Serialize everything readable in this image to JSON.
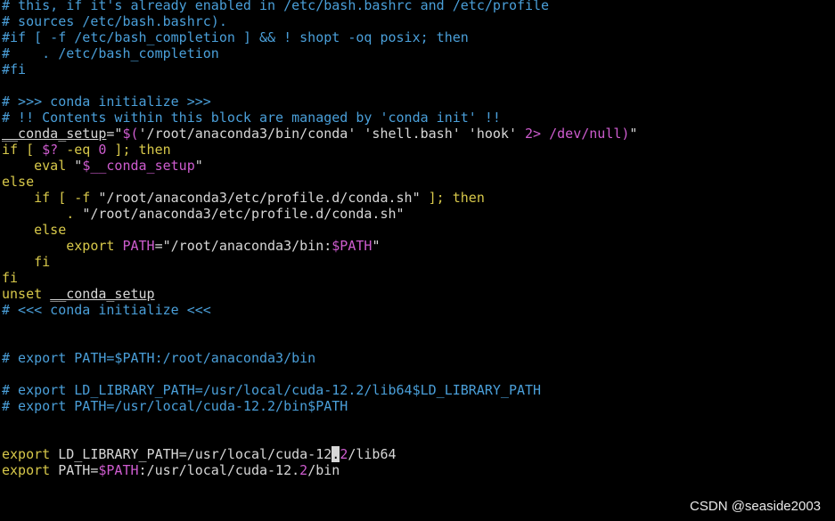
{
  "lines": [
    [
      {
        "t": "# this, if it's already enabled in /etc/bash.bashrc and /etc/profile",
        "c": "c"
      }
    ],
    [
      {
        "t": "# sources /etc/bash.bashrc).",
        "c": "c"
      }
    ],
    [
      {
        "t": "#if [ -f /etc/bash_completion ] && ! shopt -oq posix; then",
        "c": "c"
      }
    ],
    [
      {
        "t": "#    . /etc/bash_completion",
        "c": "c"
      }
    ],
    [
      {
        "t": "#fi",
        "c": "c"
      }
    ],
    [],
    [
      {
        "t": "# >>> conda initialize >>>",
        "c": "c"
      }
    ],
    [
      {
        "t": "# !! Contents within this block are managed by 'conda init' !!",
        "c": "c"
      }
    ],
    [
      {
        "t": "__conda_setup",
        "c": "t ul"
      },
      {
        "t": "=\"",
        "c": "s"
      },
      {
        "t": "$(",
        "c": "v"
      },
      {
        "t": "'/root/anaconda3/bin/conda' 'shell.bash' 'hook' ",
        "c": "s"
      },
      {
        "t": "2>",
        "c": "v"
      },
      {
        "t": " ",
        "c": "s"
      },
      {
        "t": "/dev/null)",
        "c": "v"
      },
      {
        "t": "\"",
        "c": "s"
      }
    ],
    [
      {
        "t": "if",
        "c": "k"
      },
      {
        "t": " [ ",
        "c": "k"
      },
      {
        "t": "$?",
        "c": "v"
      },
      {
        "t": " -eq ",
        "c": "k"
      },
      {
        "t": "0",
        "c": "v"
      },
      {
        "t": " ]; then",
        "c": "k"
      }
    ],
    [
      {
        "t": "    eval ",
        "c": "k"
      },
      {
        "t": "\"",
        "c": "s"
      },
      {
        "t": "$__conda_setup",
        "c": "v"
      },
      {
        "t": "\"",
        "c": "s"
      }
    ],
    [
      {
        "t": "else",
        "c": "k"
      }
    ],
    [
      {
        "t": "    if [ -f ",
        "c": "k"
      },
      {
        "t": "\"/root/anaconda3/etc/profile.d/conda.sh\"",
        "c": "s"
      },
      {
        "t": " ]; then",
        "c": "k"
      }
    ],
    [
      {
        "t": "        . ",
        "c": "k"
      },
      {
        "t": "\"/root/anaconda3/etc/profile.d/conda.sh\"",
        "c": "s"
      }
    ],
    [
      {
        "t": "    else",
        "c": "k"
      }
    ],
    [
      {
        "t": "        export ",
        "c": "k"
      },
      {
        "t": "PATH",
        "c": "v"
      },
      {
        "t": "=\"/root/anaconda3/bin:",
        "c": "s"
      },
      {
        "t": "$PATH",
        "c": "v"
      },
      {
        "t": "\"",
        "c": "s"
      }
    ],
    [
      {
        "t": "    fi",
        "c": "k"
      }
    ],
    [
      {
        "t": "fi",
        "c": "k"
      }
    ],
    [
      {
        "t": "unset ",
        "c": "k"
      },
      {
        "t": "__conda_setup",
        "c": "t ul"
      }
    ],
    [
      {
        "t": "# <<< conda initialize <<<",
        "c": "c"
      }
    ],
    [],
    [],
    [
      {
        "t": "# export PATH=$PATH:/root/anaconda3/bin",
        "c": "c"
      }
    ],
    [],
    [
      {
        "t": "# export LD_LIBRARY_PATH=/usr/local/cuda-12.2/lib64$LD_LIBRARY_PATH",
        "c": "c"
      }
    ],
    [
      {
        "t": "# export PATH=/usr/local/cuda-12.2/bin$PATH",
        "c": "c"
      }
    ],
    [],
    [],
    [
      {
        "t": "export ",
        "c": "k"
      },
      {
        "t": "LD_LIBRARY_PATH",
        "c": "t"
      },
      {
        "t": "=/usr/local/cuda-12",
        "c": "t"
      },
      {
        "t": ".",
        "c": "cur"
      },
      {
        "t": "2",
        "c": "v"
      },
      {
        "t": "/lib64",
        "c": "t"
      }
    ],
    [
      {
        "t": "export ",
        "c": "k"
      },
      {
        "t": "PATH",
        "c": "t"
      },
      {
        "t": "=",
        "c": "t"
      },
      {
        "t": "$PATH",
        "c": "v"
      },
      {
        "t": ":/usr/local/cuda-12.",
        "c": "t"
      },
      {
        "t": "2",
        "c": "v"
      },
      {
        "t": "/bin",
        "c": "t"
      }
    ]
  ],
  "watermark": "CSDN @seaside2003"
}
